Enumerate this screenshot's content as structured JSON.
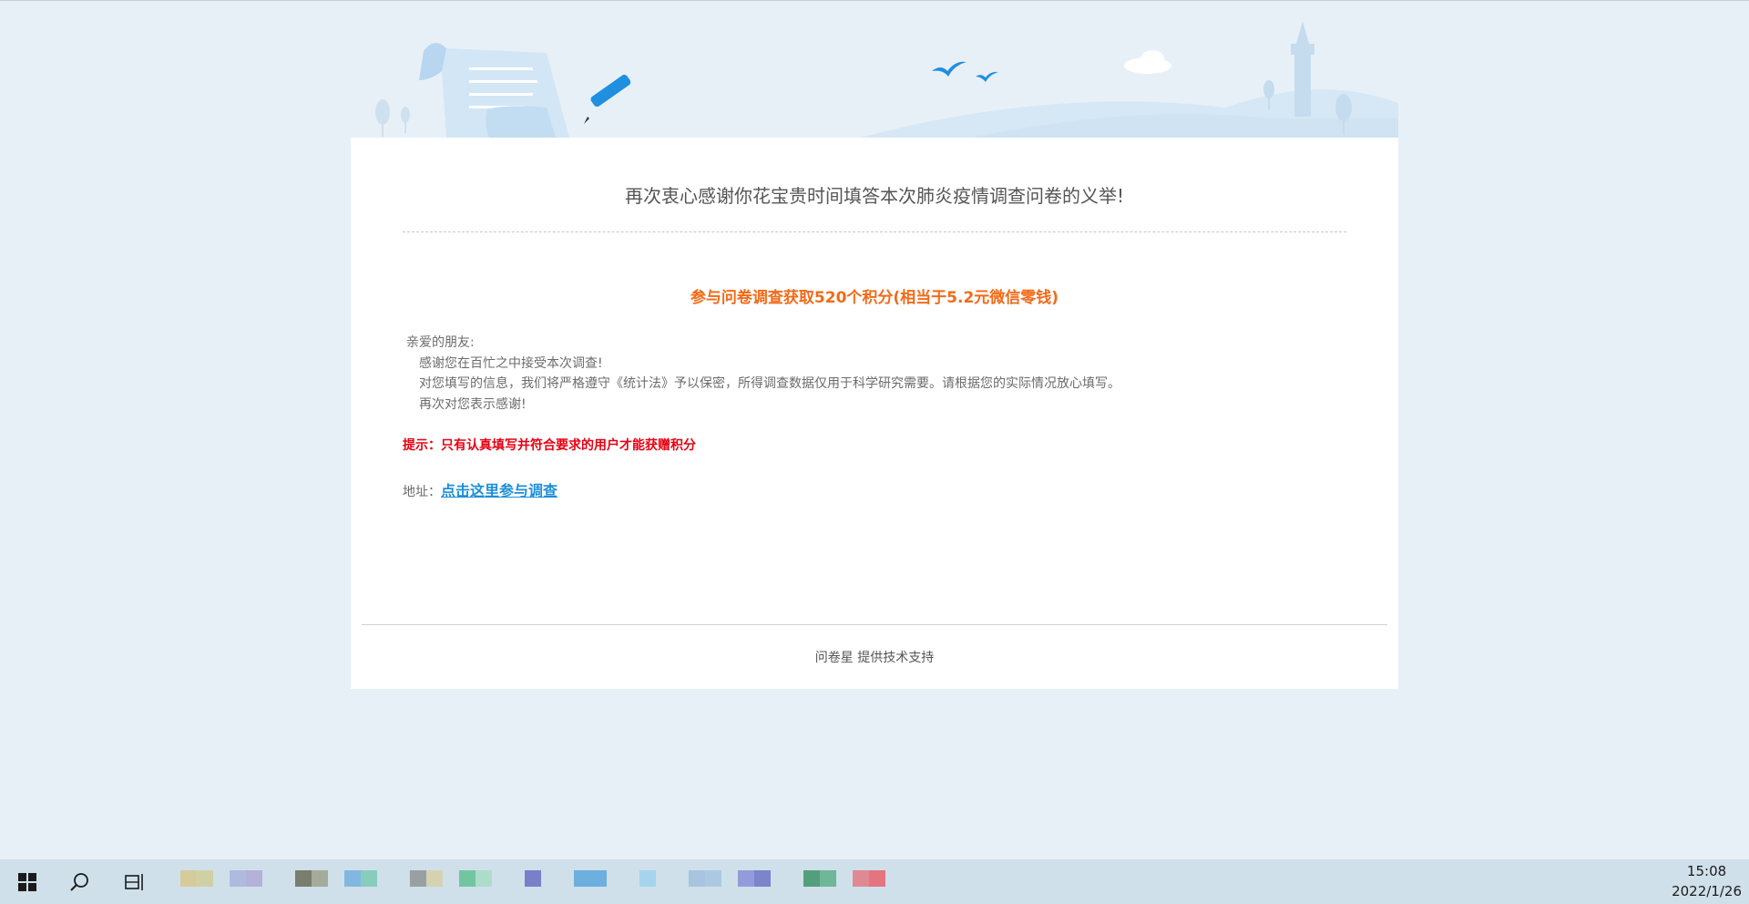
{
  "survey": {
    "headline": "再次衷心感谢你花宝贵时间填答本次肺炎疫情调查问卷的义举!",
    "reward": "参与问卷调查获取520个积分(相当于5.2元微信零钱)",
    "letter": {
      "greeting": "亲爱的朋友:",
      "line1": "感谢您在百忙之中接受本次调查!",
      "line2": "对您填写的信息，我们将严格遵守《统计法》予以保密，所得调查数据仅用于科学研究需要。请根据您的实际情况放心填写。",
      "line3": "再次对您表示感谢!"
    },
    "tip": "提示：只有认真填写并符合要求的用户才能获赠积分",
    "address_label": "地址：",
    "address_link": "点击这里参与调查",
    "powered_by": "问卷星 提供技术支持"
  },
  "taskbar": {
    "time": "15:08",
    "date": "2022/1/26",
    "icons": [
      "windows-start-icon",
      "search-icon",
      "task-view-icon"
    ]
  },
  "colors": {
    "background": "#e8f0f7",
    "reward": "#f26a18",
    "tip": "#e60012",
    "link": "#1d8fd8"
  }
}
